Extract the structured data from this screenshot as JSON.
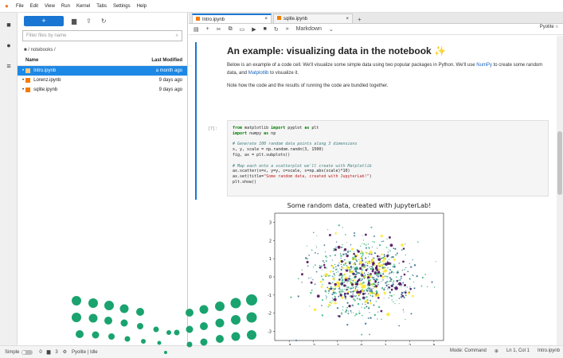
{
  "menu": {
    "items": [
      "File",
      "Edit",
      "View",
      "Run",
      "Kernel",
      "Tabs",
      "Settings",
      "Help"
    ]
  },
  "file_browser": {
    "new_button": "+",
    "filter_placeholder": "Filter files by name",
    "breadcrumb": "/ notebooks /",
    "header_name": "Name",
    "header_modified": "Last Modified",
    "files": [
      {
        "name": "Intro.ipynb",
        "modified": "a month ago",
        "selected": true
      },
      {
        "name": "Lorenz.ipynb",
        "modified": "9 days ago",
        "selected": false
      },
      {
        "name": "sqlite.ipynb",
        "modified": "9 days ago",
        "selected": false
      }
    ]
  },
  "tabs": [
    {
      "label": "Intro.ipynb",
      "active": true
    },
    {
      "label": "sqlite.ipynb",
      "active": false
    }
  ],
  "notebook_toolbar": {
    "cell_type": "Markdown",
    "kernel": "Pyolite"
  },
  "markdown_cell": {
    "heading": "An example: visualizing data in the notebook ✨",
    "p1_a": "Below is an example of a code cell. We'll visualize some simple data using two popular packages in Python. We'll use ",
    "p1_link1": "NumPy",
    "p1_b": " to create some random data, and ",
    "p1_link2": "Matplotlib",
    "p1_c": " to visualize it.",
    "p2": "Note how the code and the results of running the code are bundled together."
  },
  "code_cell": {
    "prompt": "[7]:",
    "lines": [
      "from matplotlib import pyplot as plt",
      "import numpy as np",
      "",
      "# Generate 100 random data points along 3 dimensions",
      "x, y, scale = np.random.randn(3, 1500)",
      "fig, ax = plt.subplots()",
      "",
      "# Map each onto a scatterplot we'll create with Matplotlib",
      "ax.scatter(x=x, y=y, c=scale, s=np.abs(scale)*10)",
      "ax.set(title=\"Some random data, created with JupyterLab!\")",
      "plt.show()"
    ]
  },
  "chart_data": {
    "type": "scatter",
    "title": "Some random data, created with JupyterLab!",
    "xlabel": "",
    "ylabel": "",
    "xlim": [
      -3.6,
      3.4
    ],
    "ylim": [
      -3.5,
      3.5
    ],
    "xticks": [
      -3,
      -2,
      -1,
      0,
      1,
      2,
      3
    ],
    "yticks": [
      -3,
      -2,
      -1,
      0,
      1,
      2,
      3
    ],
    "distribution": "standard normal, 1500 points",
    "colormap": [
      "#440154",
      "#31688e",
      "#35b779",
      "#fde725"
    ]
  },
  "statusbar": {
    "mode_label": "Simple",
    "count1": "0",
    "count2": "3",
    "kernel_status": "Pyolite | Idle",
    "mode": "Mode: Command",
    "position": "Ln 1, Col 1",
    "file": "Intro.ipynb"
  },
  "colors": {
    "accent": "#1976d2",
    "selected_row": "#1e88e5",
    "brand_orange": "#f37726",
    "logo_green": "#1aa36f"
  }
}
